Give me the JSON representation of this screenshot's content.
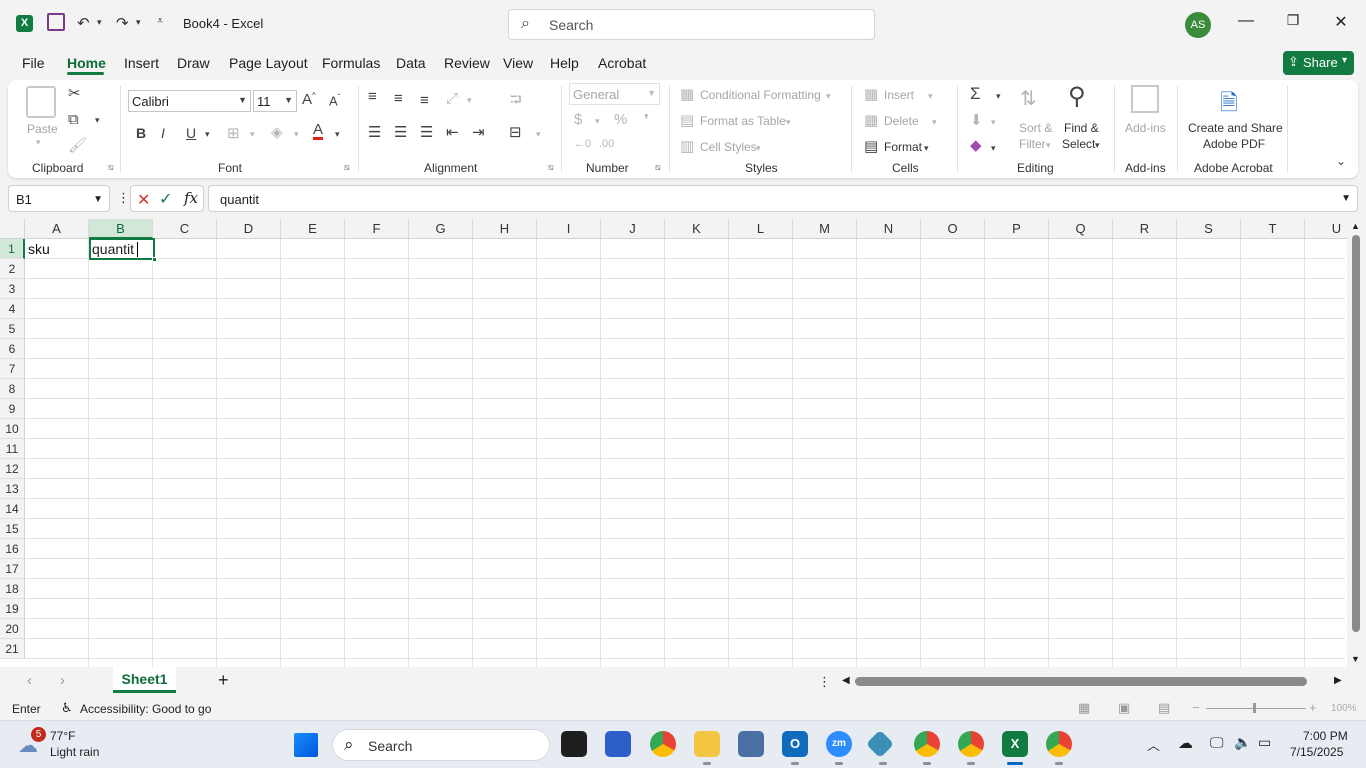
{
  "window": {
    "title": "Book4  -  Excel",
    "search_placeholder": "Search",
    "avatar_initials": "AS",
    "accent": "#107c41"
  },
  "menu": {
    "tabs": [
      "File",
      "Home",
      "Insert",
      "Draw",
      "Page Layout",
      "Formulas",
      "Data",
      "Review",
      "View",
      "Help",
      "Acrobat"
    ],
    "active": "Home",
    "share_label": "Share"
  },
  "ribbon": {
    "clipboard": {
      "paste": "Paste",
      "label": "Clipboard"
    },
    "font": {
      "name": "Calibri",
      "size": "11",
      "label": "Font",
      "bold": "B",
      "italic": "I",
      "underline": "U"
    },
    "alignment": {
      "label": "Alignment"
    },
    "number": {
      "format": "General",
      "label": "Number"
    },
    "styles": {
      "conditional": "Conditional Formatting",
      "table": "Format as Table",
      "cell_styles": "Cell Styles",
      "label": "Styles"
    },
    "cells": {
      "insert": "Insert",
      "delete": "Delete",
      "format": "Format",
      "label": "Cells"
    },
    "editing": {
      "sort_line1": "Sort &",
      "sort_line2": "Filter",
      "find_line1": "Find &",
      "find_line2": "Select",
      "label": "Editing"
    },
    "addins": {
      "button": "Add-ins",
      "label": "Add-ins"
    },
    "acrobat": {
      "line1": "Create and Share",
      "line2": "Adobe PDF",
      "label": "Adobe Acrobat"
    }
  },
  "formula_bar": {
    "name_box": "B1",
    "content": "quantit"
  },
  "grid": {
    "columns": [
      "A",
      "B",
      "C",
      "D",
      "E",
      "F",
      "G",
      "H",
      "I",
      "J",
      "K",
      "L",
      "M",
      "N",
      "O",
      "P",
      "Q",
      "R",
      "S",
      "T",
      "U"
    ],
    "rows": [
      "1",
      "2",
      "3",
      "4",
      "5",
      "6",
      "7",
      "8",
      "9",
      "10",
      "11",
      "12",
      "13",
      "14",
      "15",
      "16",
      "17",
      "18",
      "19",
      "20",
      "21"
    ],
    "selected_column": "B",
    "selected_row": "1",
    "cells": {
      "A1": "sku",
      "B1": "quantit"
    }
  },
  "sheets": {
    "tabs": [
      "Sheet1"
    ],
    "active": "Sheet1"
  },
  "status": {
    "mode": "Enter",
    "accessibility": "Accessibility: Good to go",
    "zoom": "100%"
  },
  "taskbar": {
    "weather_temp": "77°F",
    "weather_desc": "Light rain",
    "weather_badge": "5",
    "search": "Search",
    "time": "7:00 PM",
    "date": "7/15/2025"
  }
}
